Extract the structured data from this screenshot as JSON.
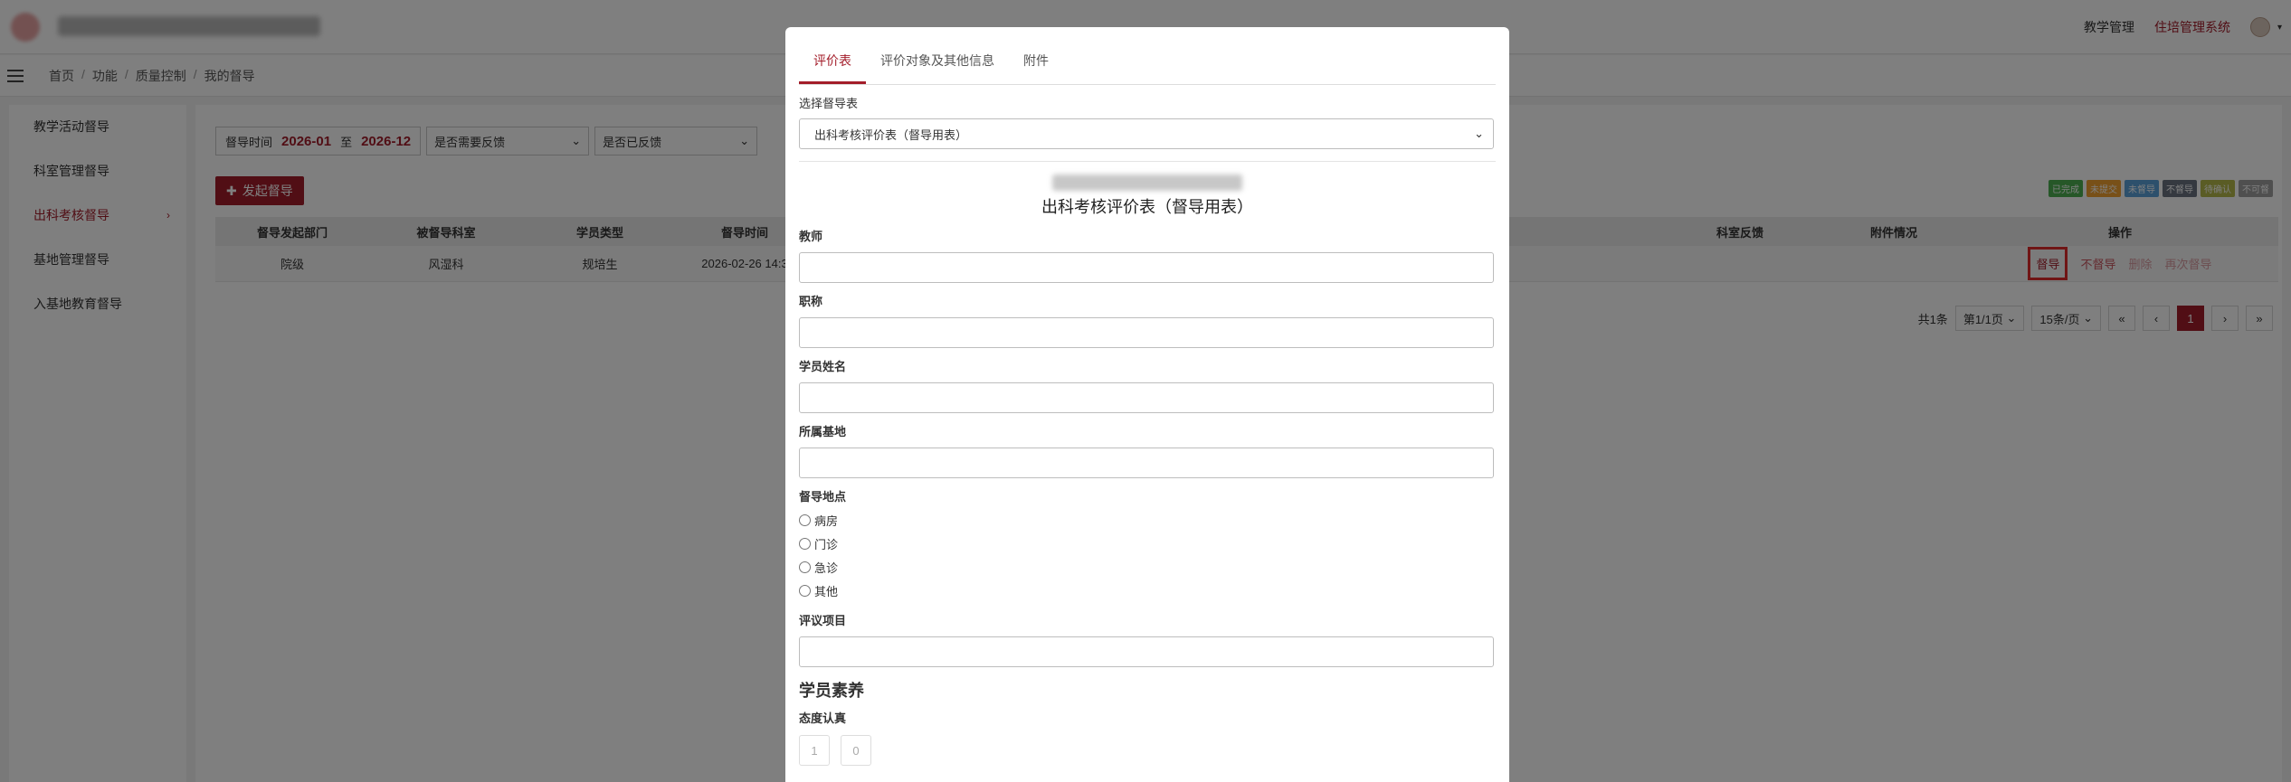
{
  "header": {
    "nav": [
      "教学管理",
      "住培管理系统"
    ]
  },
  "breadcrumb": [
    "首页",
    "功能",
    "质量控制",
    "我的督导"
  ],
  "sidebar": {
    "items": [
      {
        "label": "教学活动督导"
      },
      {
        "label": "科室管理督导"
      },
      {
        "label": "出科考核督导"
      },
      {
        "label": "基地管理督导"
      },
      {
        "label": "入基地教育督导"
      }
    ]
  },
  "filters": {
    "range_label": "督导时间",
    "from": "2026-01",
    "sep": "至",
    "to": "2026-12",
    "need_feedback": "是否需要反馈",
    "has_feedback": "是否已反馈"
  },
  "actions": {
    "start": "发起督导"
  },
  "legend": [
    {
      "label": "已完成",
      "color": "#4caf50"
    },
    {
      "label": "未提交",
      "color": "#f0a030"
    },
    {
      "label": "未督导",
      "color": "#5aa0d8"
    },
    {
      "label": "不督导",
      "color": "#6b7280"
    },
    {
      "label": "待确认",
      "color": "#b5b84a"
    },
    {
      "label": "不可督",
      "color": "#9e9e9e"
    }
  ],
  "table": {
    "columns": [
      "督导发起部门",
      "被督导科室",
      "学员类型",
      "督导时间",
      "科室反馈",
      "附件情况",
      "操作"
    ],
    "row": {
      "dept": "院级",
      "subject": "风湿科",
      "type": "规培生",
      "time": "2026-02-26 14:3",
      "ops": [
        "督导",
        "不督导",
        "删除",
        "再次督导"
      ]
    }
  },
  "pager": {
    "total": "共1条",
    "page": "第1/1页",
    "size": "15条/页",
    "first": "«",
    "prev": "‹",
    "current": "1",
    "next": "›",
    "last": "»"
  },
  "modal": {
    "tabs": [
      "评价表",
      "评价对象及其他信息",
      "附件"
    ],
    "select_label": "选择督导表",
    "select_value": "出科考核评价表（督导用表）",
    "form_title": "出科考核评价表（督导用表）",
    "fields": [
      "教师",
      "职称",
      "学员姓名",
      "所属基地"
    ],
    "location_label": "督导地点",
    "locations": [
      "病房",
      "门诊",
      "急诊",
      "其他"
    ],
    "item_label": "评议项目",
    "section": "学员素养",
    "sub_item": "态度认真",
    "scores": [
      "1",
      "0"
    ]
  }
}
